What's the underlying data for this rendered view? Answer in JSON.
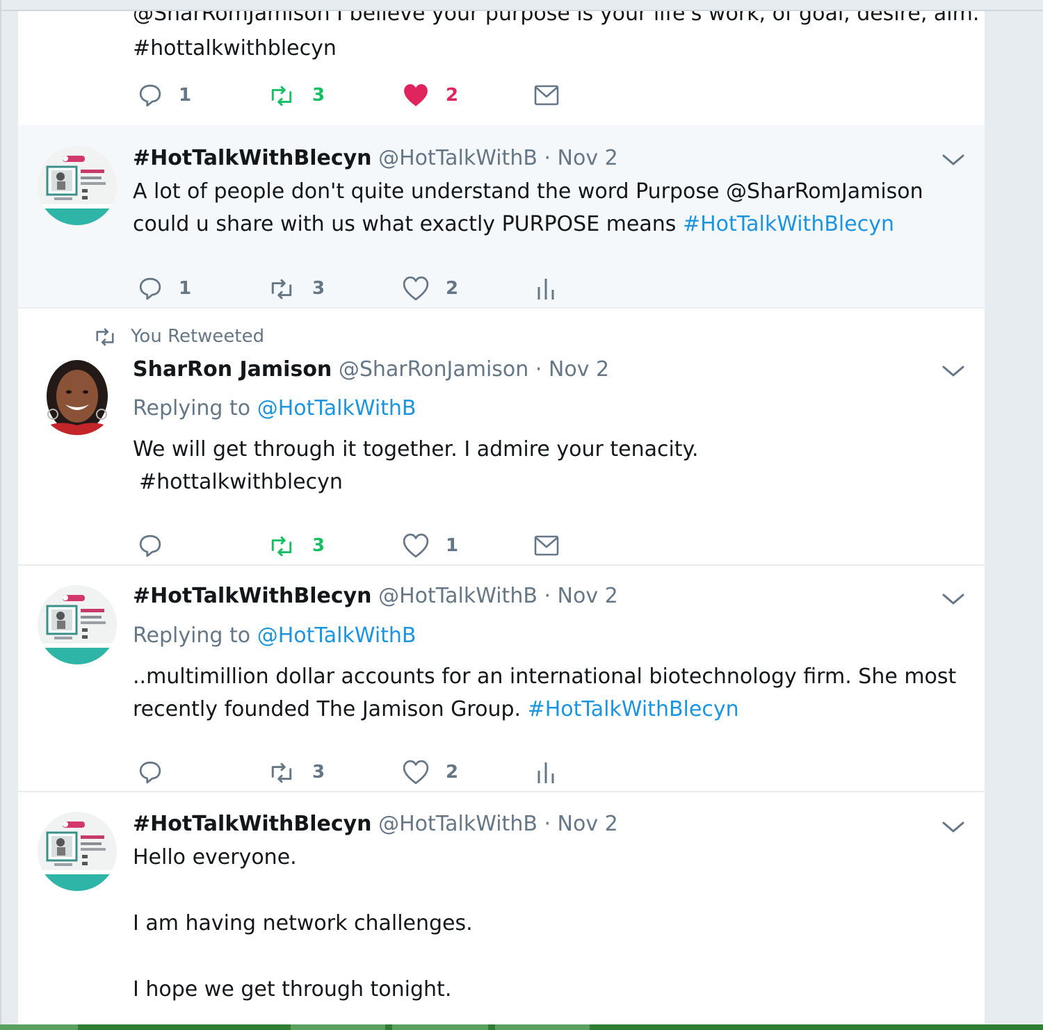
{
  "colors": {
    "link": "#1b95e0",
    "retweet_active": "#17bf63",
    "like_active": "#e0245e",
    "muted": "#657786"
  },
  "tweets": [
    {
      "text_line1": "@SharRomJamison I believe your purpose is your life's work, of goal, desire, aim.",
      "hashtag": "#hottalkwithblecyn",
      "reply_count": "1",
      "retweet_count": "3",
      "like_count": "2",
      "last_action_icon": "envelope-icon"
    },
    {
      "name": "#HotTalkWithBlecyn",
      "handle": "@HotTalkWithB",
      "date": "· Nov 2",
      "text_line1": "A lot of people don't quite understand the word Purpose @SharRomJamison",
      "text_line2_prefix": "could u share with us what exactly PURPOSE means ",
      "hashtag": "#HotTalkWithBlecyn",
      "reply_count": "1",
      "retweet_count": "3",
      "like_count": "2",
      "last_action_icon": "analytics-icon"
    },
    {
      "context": "You Retweeted",
      "name": "SharRon Jamison",
      "handle": "@SharRonJamison",
      "date": "· Nov 2",
      "replying_label": "Replying to",
      "replying_to": "@HotTalkWithB",
      "text_line1": "We will get through it together. I admire your tenacity.",
      "hashtag": "#hottalkwithblecyn",
      "retweet_count": "3",
      "like_count": "1",
      "last_action_icon": "envelope-icon"
    },
    {
      "name": "#HotTalkWithBlecyn",
      "handle": "@HotTalkWithB",
      "date": "· Nov 2",
      "replying_label": "Replying to",
      "replying_to": "@HotTalkWithB",
      "text_line1": "..multimillion dollar accounts for an international biotechnology firm. She most",
      "text_line2_prefix": "recently founded The Jamison Group. ",
      "hashtag": "#HotTalkWithBlecyn",
      "retweet_count": "3",
      "like_count": "2",
      "last_action_icon": "analytics-icon"
    },
    {
      "name": "#HotTalkWithBlecyn",
      "handle": "@HotTalkWithB",
      "date": "· Nov 2",
      "text_line1": "Hello everyone.",
      "text_line2": "I am having network challenges.",
      "text_line3": "I hope we get through tonight."
    }
  ]
}
